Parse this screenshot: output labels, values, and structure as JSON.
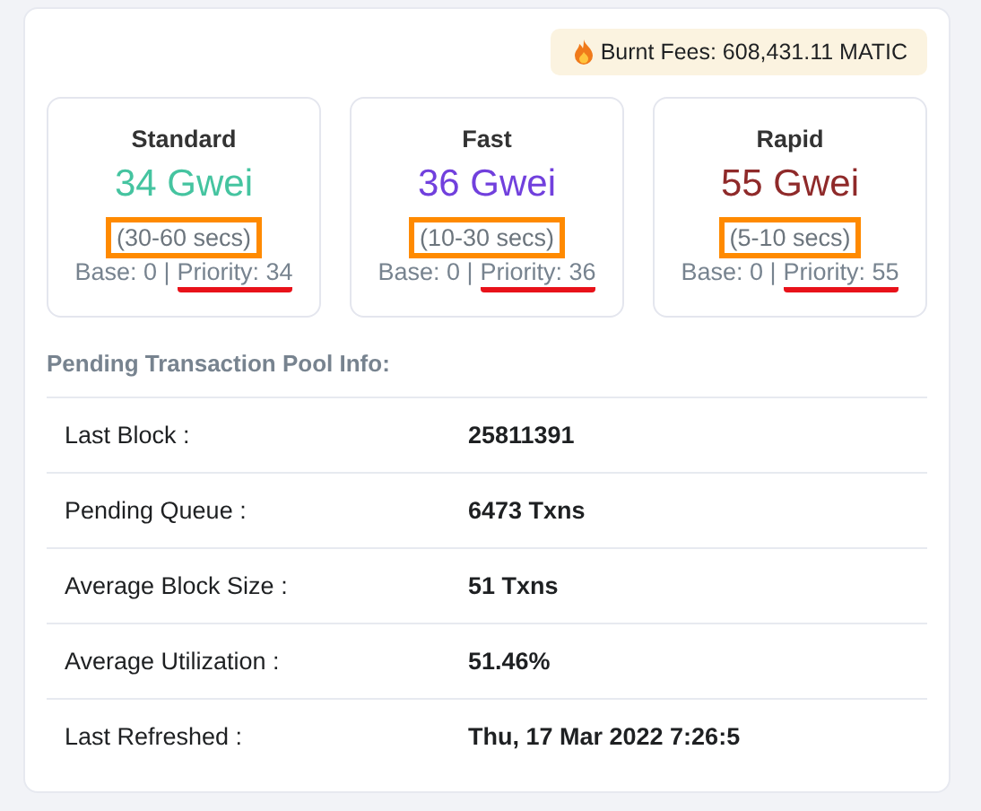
{
  "burnt_fees": {
    "label": "Burnt Fees: 608,431.11 MATIC"
  },
  "tiers": [
    {
      "name": "Standard",
      "price": "34 Gwei",
      "color": "#45c4a0",
      "time": "(30-60 secs)",
      "highlighted": true,
      "base": "Base: 0 |",
      "priority": "Priority: 34",
      "underlined": true
    },
    {
      "name": "Fast",
      "price": "36 Gwei",
      "color": "#7140dd",
      "time": "(10-30 secs)",
      "highlighted": true,
      "base": "Base: 0 |",
      "priority": "Priority: 36",
      "underlined": true
    },
    {
      "name": "Rapid",
      "price": "55 Gwei",
      "color": "#8f2a2a",
      "time": "(5-10 secs)",
      "highlighted": true,
      "base": "Base: 0 |",
      "priority": "Priority: 55",
      "underlined": true
    }
  ],
  "pool": {
    "title": "Pending Transaction Pool Info:",
    "rows": [
      {
        "label": "Last Block :",
        "value": "25811391"
      },
      {
        "label": "Pending Queue :",
        "value": "6473 Txns"
      },
      {
        "label": "Average Block Size :",
        "value": "51 Txns"
      },
      {
        "label": "Average Utilization :",
        "value": "51.46%"
      },
      {
        "label": "Last Refreshed :",
        "value": "Thu, 17 Mar 2022 7:26:5"
      }
    ]
  }
}
